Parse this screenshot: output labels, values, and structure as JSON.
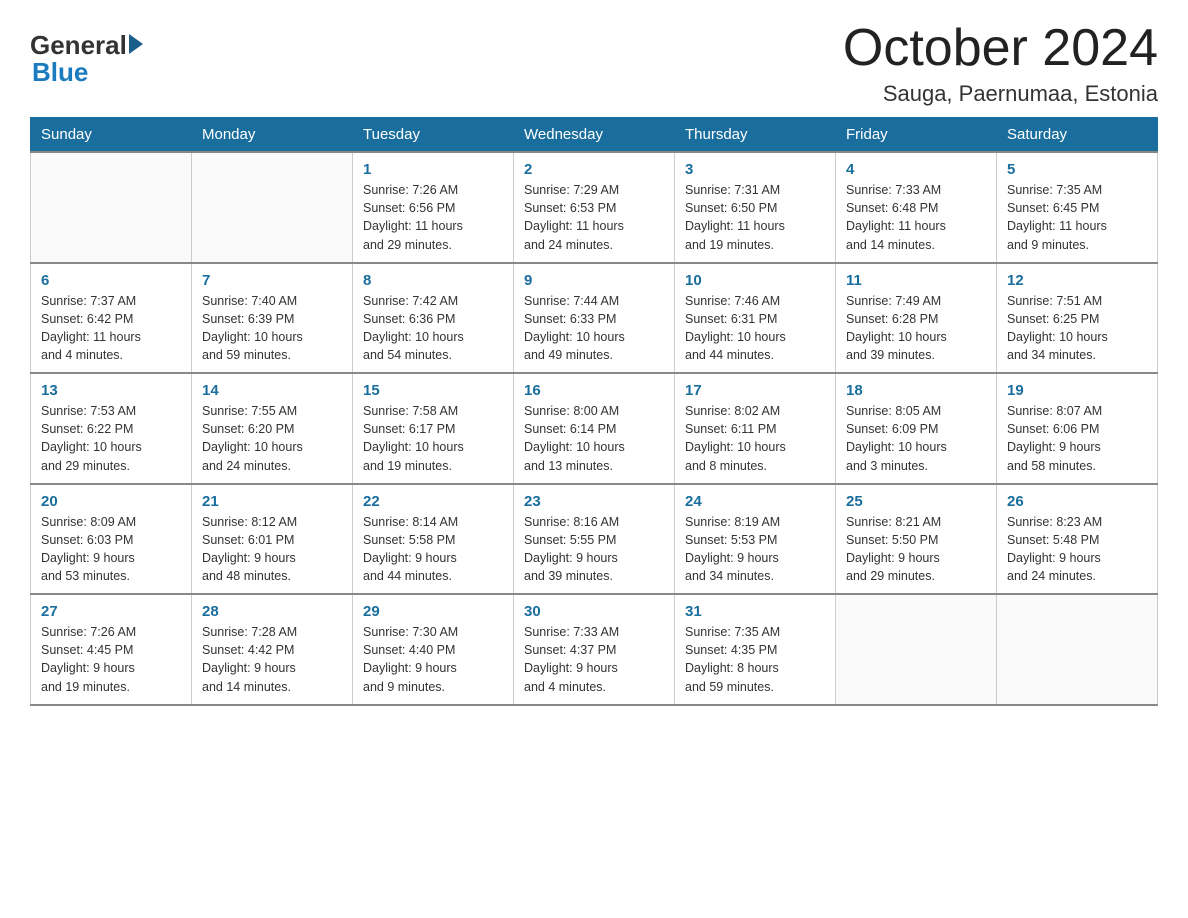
{
  "header": {
    "logo_general": "General",
    "logo_blue": "Blue",
    "month_title": "October 2024",
    "location": "Sauga, Paernumaa, Estonia"
  },
  "days_of_week": [
    "Sunday",
    "Monday",
    "Tuesday",
    "Wednesday",
    "Thursday",
    "Friday",
    "Saturday"
  ],
  "weeks": [
    [
      {
        "day": "",
        "info": ""
      },
      {
        "day": "",
        "info": ""
      },
      {
        "day": "1",
        "info": "Sunrise: 7:26 AM\nSunset: 6:56 PM\nDaylight: 11 hours\nand 29 minutes."
      },
      {
        "day": "2",
        "info": "Sunrise: 7:29 AM\nSunset: 6:53 PM\nDaylight: 11 hours\nand 24 minutes."
      },
      {
        "day": "3",
        "info": "Sunrise: 7:31 AM\nSunset: 6:50 PM\nDaylight: 11 hours\nand 19 minutes."
      },
      {
        "day": "4",
        "info": "Sunrise: 7:33 AM\nSunset: 6:48 PM\nDaylight: 11 hours\nand 14 minutes."
      },
      {
        "day": "5",
        "info": "Sunrise: 7:35 AM\nSunset: 6:45 PM\nDaylight: 11 hours\nand 9 minutes."
      }
    ],
    [
      {
        "day": "6",
        "info": "Sunrise: 7:37 AM\nSunset: 6:42 PM\nDaylight: 11 hours\nand 4 minutes."
      },
      {
        "day": "7",
        "info": "Sunrise: 7:40 AM\nSunset: 6:39 PM\nDaylight: 10 hours\nand 59 minutes."
      },
      {
        "day": "8",
        "info": "Sunrise: 7:42 AM\nSunset: 6:36 PM\nDaylight: 10 hours\nand 54 minutes."
      },
      {
        "day": "9",
        "info": "Sunrise: 7:44 AM\nSunset: 6:33 PM\nDaylight: 10 hours\nand 49 minutes."
      },
      {
        "day": "10",
        "info": "Sunrise: 7:46 AM\nSunset: 6:31 PM\nDaylight: 10 hours\nand 44 minutes."
      },
      {
        "day": "11",
        "info": "Sunrise: 7:49 AM\nSunset: 6:28 PM\nDaylight: 10 hours\nand 39 minutes."
      },
      {
        "day": "12",
        "info": "Sunrise: 7:51 AM\nSunset: 6:25 PM\nDaylight: 10 hours\nand 34 minutes."
      }
    ],
    [
      {
        "day": "13",
        "info": "Sunrise: 7:53 AM\nSunset: 6:22 PM\nDaylight: 10 hours\nand 29 minutes."
      },
      {
        "day": "14",
        "info": "Sunrise: 7:55 AM\nSunset: 6:20 PM\nDaylight: 10 hours\nand 24 minutes."
      },
      {
        "day": "15",
        "info": "Sunrise: 7:58 AM\nSunset: 6:17 PM\nDaylight: 10 hours\nand 19 minutes."
      },
      {
        "day": "16",
        "info": "Sunrise: 8:00 AM\nSunset: 6:14 PM\nDaylight: 10 hours\nand 13 minutes."
      },
      {
        "day": "17",
        "info": "Sunrise: 8:02 AM\nSunset: 6:11 PM\nDaylight: 10 hours\nand 8 minutes."
      },
      {
        "day": "18",
        "info": "Sunrise: 8:05 AM\nSunset: 6:09 PM\nDaylight: 10 hours\nand 3 minutes."
      },
      {
        "day": "19",
        "info": "Sunrise: 8:07 AM\nSunset: 6:06 PM\nDaylight: 9 hours\nand 58 minutes."
      }
    ],
    [
      {
        "day": "20",
        "info": "Sunrise: 8:09 AM\nSunset: 6:03 PM\nDaylight: 9 hours\nand 53 minutes."
      },
      {
        "day": "21",
        "info": "Sunrise: 8:12 AM\nSunset: 6:01 PM\nDaylight: 9 hours\nand 48 minutes."
      },
      {
        "day": "22",
        "info": "Sunrise: 8:14 AM\nSunset: 5:58 PM\nDaylight: 9 hours\nand 44 minutes."
      },
      {
        "day": "23",
        "info": "Sunrise: 8:16 AM\nSunset: 5:55 PM\nDaylight: 9 hours\nand 39 minutes."
      },
      {
        "day": "24",
        "info": "Sunrise: 8:19 AM\nSunset: 5:53 PM\nDaylight: 9 hours\nand 34 minutes."
      },
      {
        "day": "25",
        "info": "Sunrise: 8:21 AM\nSunset: 5:50 PM\nDaylight: 9 hours\nand 29 minutes."
      },
      {
        "day": "26",
        "info": "Sunrise: 8:23 AM\nSunset: 5:48 PM\nDaylight: 9 hours\nand 24 minutes."
      }
    ],
    [
      {
        "day": "27",
        "info": "Sunrise: 7:26 AM\nSunset: 4:45 PM\nDaylight: 9 hours\nand 19 minutes."
      },
      {
        "day": "28",
        "info": "Sunrise: 7:28 AM\nSunset: 4:42 PM\nDaylight: 9 hours\nand 14 minutes."
      },
      {
        "day": "29",
        "info": "Sunrise: 7:30 AM\nSunset: 4:40 PM\nDaylight: 9 hours\nand 9 minutes."
      },
      {
        "day": "30",
        "info": "Sunrise: 7:33 AM\nSunset: 4:37 PM\nDaylight: 9 hours\nand 4 minutes."
      },
      {
        "day": "31",
        "info": "Sunrise: 7:35 AM\nSunset: 4:35 PM\nDaylight: 8 hours\nand 59 minutes."
      },
      {
        "day": "",
        "info": ""
      },
      {
        "day": "",
        "info": ""
      }
    ]
  ]
}
